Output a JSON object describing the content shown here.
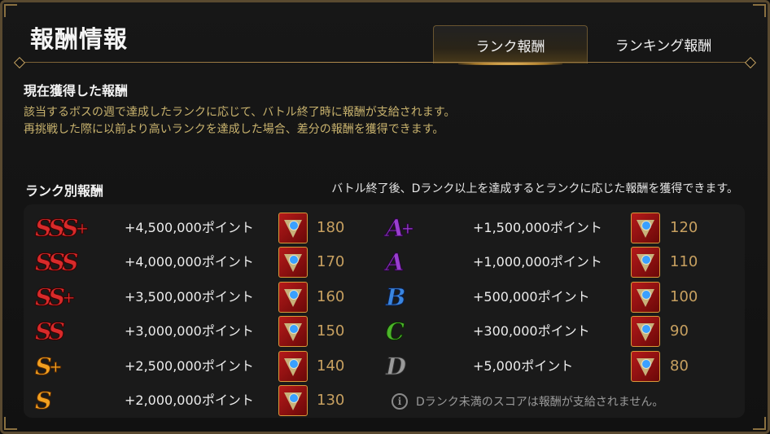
{
  "header": {
    "title": "報酬情報",
    "tabs": [
      {
        "label": "ランク報酬",
        "active": true
      },
      {
        "label": "ランキング報酬",
        "active": false
      }
    ]
  },
  "current": {
    "heading": "現在獲得した報酬",
    "line1": "該当するボスの週で達成したランクに応じて、バトル終了時に報酬が支給されます。",
    "line2": "再挑戦した際に以前より高いランクを達成した場合、差分の報酬を獲得できます。"
  },
  "rank_rewards": {
    "heading": "ランク別報酬",
    "note": "バトル終了後、Dランク以上を達成するとランクに応じた報酬を獲得できます。",
    "left": [
      {
        "rank": "SSS",
        "plus": "+",
        "points": "+4,500,000ポイント",
        "count": "180"
      },
      {
        "rank": "SSS",
        "plus": "",
        "points": "+4,000,000ポイント",
        "count": "170"
      },
      {
        "rank": "SS",
        "plus": "+",
        "points": "+3,500,000ポイント",
        "count": "160"
      },
      {
        "rank": "SS",
        "plus": "",
        "points": "+3,000,000ポイント",
        "count": "150"
      },
      {
        "rank": "S",
        "plus": "+",
        "points": "+2,500,000ポイント",
        "count": "140"
      },
      {
        "rank": "S",
        "plus": "",
        "points": "+2,000,000ポイント",
        "count": "130"
      }
    ],
    "right": [
      {
        "rank": "A",
        "plus": "+",
        "points": "+1,500,000ポイント",
        "count": "120"
      },
      {
        "rank": "A",
        "plus": "",
        "points": "+1,000,000ポイント",
        "count": "110"
      },
      {
        "rank": "B",
        "plus": "",
        "points": "+500,000ポイント",
        "count": "100"
      },
      {
        "rank": "C",
        "plus": "",
        "points": "+300,000ポイント",
        "count": "90"
      },
      {
        "rank": "D",
        "plus": "",
        "points": "+5,000ポイント",
        "count": "80"
      }
    ],
    "info_icon": "i",
    "info": "Dランク未満のスコアは報酬が支給されません。"
  },
  "colors": {
    "accent_gold": "#c9b36e",
    "rank_red": "#d82a2a",
    "rank_gold": "#f2a020",
    "rank_purple": "#9a3ed0",
    "rank_blue": "#3a86e0",
    "rank_green": "#4cb42a",
    "rank_grey": "#9a9a9a"
  }
}
